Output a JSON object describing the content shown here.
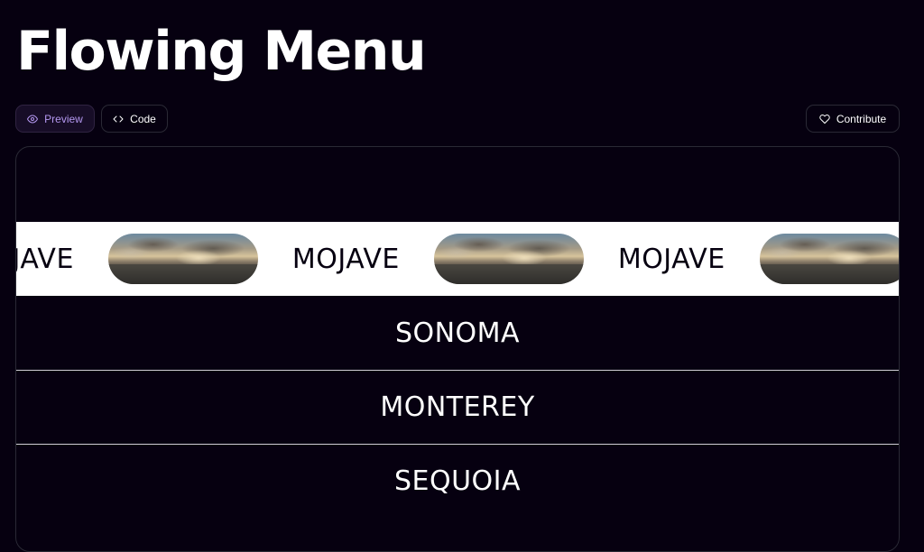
{
  "page": {
    "title": "Flowing Menu"
  },
  "toolbar": {
    "preview_label": "Preview",
    "code_label": "Code",
    "contribute_label": "Contribute",
    "accent_color": "#b498f0"
  },
  "menu": {
    "active_item": {
      "label": "MOJAVE",
      "marquee_text": [
        "MOJAVE",
        "MOJAVE",
        "MOJAVE"
      ],
      "image": "ocean-sunset-clouds-image"
    },
    "items": [
      {
        "label": "SONOMA"
      },
      {
        "label": "MONTEREY"
      },
      {
        "label": "SEQUOIA"
      }
    ]
  },
  "icons": {
    "preview": "eye-icon",
    "code": "code-brackets-icon",
    "contribute": "heart-icon"
  }
}
